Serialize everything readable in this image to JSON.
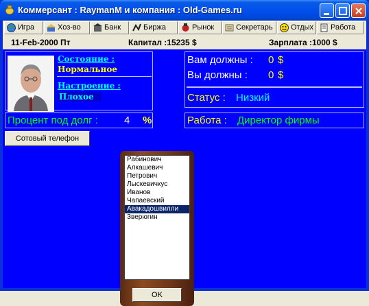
{
  "window": {
    "title": "Коммерсант : RaymanM и компания : Old-Games.ru"
  },
  "toolbar": {
    "items": [
      {
        "label": "Игра",
        "icon": "globe-icon"
      },
      {
        "label": "Хоз-во",
        "icon": "farm-icon"
      },
      {
        "label": "Банк",
        "icon": "bank-icon"
      },
      {
        "label": "Биржа",
        "icon": "exchange-icon"
      },
      {
        "label": "Рынок",
        "icon": "market-icon"
      },
      {
        "label": "Секретарь",
        "icon": "secretary-icon"
      },
      {
        "label": "Отдых",
        "icon": "smiley-icon"
      },
      {
        "label": "Работа",
        "icon": "work-icon"
      }
    ]
  },
  "infobar": {
    "date": "11-Feb-2000 Пт",
    "capital": "Капитал :15235 $",
    "salary": "Зарплата :1000 $"
  },
  "status": {
    "state_label": "Состояние :",
    "state_value": "Нормальное",
    "mood_label": "Настроение :",
    "mood_value": "Плохое"
  },
  "finance": {
    "owed_to_you_label": "Вам должны :",
    "owed_to_you_value": "0",
    "currency": "$",
    "you_owe_label": "Вы должны  :",
    "you_owe_value": "0",
    "status_label": "Статус :",
    "status_value": "Низкий"
  },
  "loan": {
    "label": "Процент под долг :",
    "value": "4",
    "unit": "%"
  },
  "job": {
    "label": "Работа :",
    "value": "Директор фирмы"
  },
  "phone_button": {
    "label": "Сотовый телефон"
  },
  "phone": {
    "contacts": [
      "Рабинович",
      "Алкашевич",
      "Петрович",
      "Лыскевичкус",
      "Иванов",
      "Чапаевский",
      "Авакадошвилли",
      "Зверюгин"
    ],
    "selected_index": 6,
    "ok_label": "OK"
  },
  "colors": {
    "accent_yellow": "#ffff00",
    "cyan": "#00ffff",
    "green": "#00ff00",
    "panel_blue": "#0000ff"
  }
}
